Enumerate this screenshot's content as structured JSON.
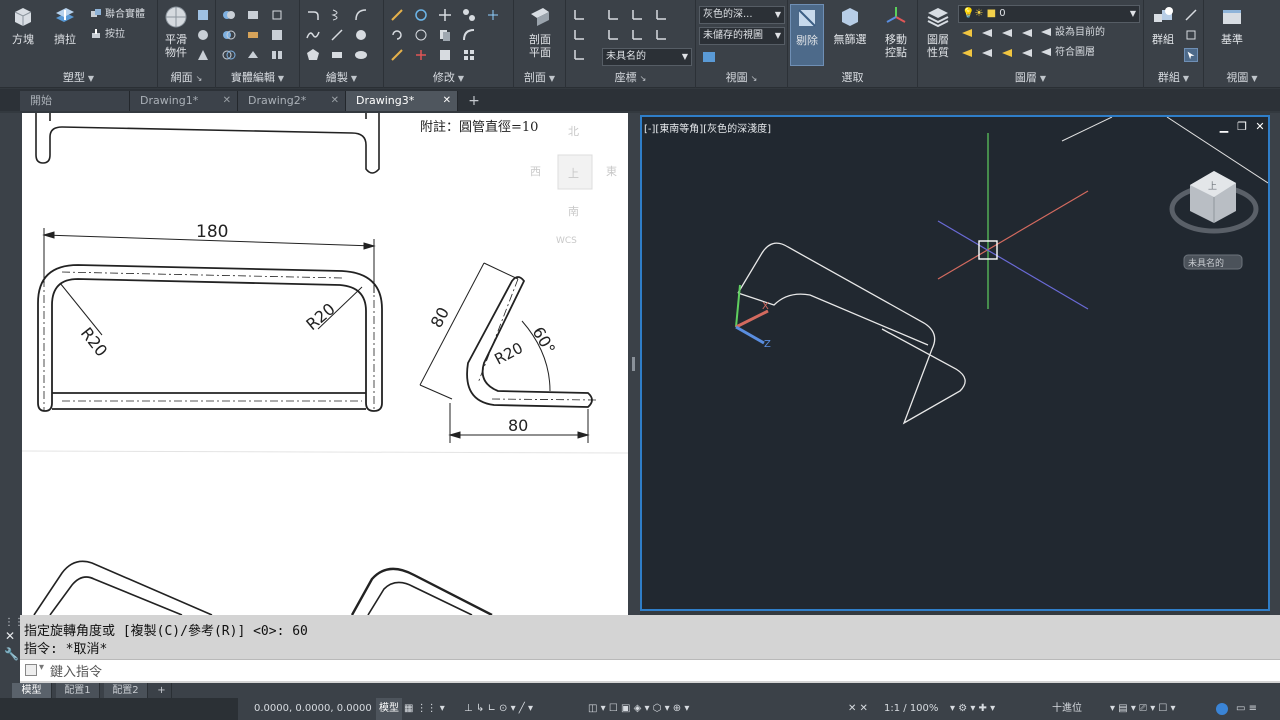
{
  "ribbon": {
    "panels": {
      "modeling": "塑型",
      "mesh": "網面",
      "solid_edit": "實體編輯",
      "draw": "繪製",
      "modify": "修改",
      "section": "剖面",
      "coordinates": "座標",
      "view": "視圖",
      "selection": "選取",
      "layers": "圖層",
      "groups": "群組",
      "view2": "視圖"
    },
    "buttons": {
      "box": "方塊",
      "extrude": "擠拉",
      "smooth_object": "平滑\n物件",
      "section_plane": "剖面\n平面",
      "culling": "剔除",
      "no_filter": "無篩選",
      "move_gizmo": "移動\n控點",
      "layer_properties": "圖層\n性質",
      "group": "群組",
      "base": "基準"
    },
    "small": {
      "solid_union": "聯合實體",
      "presspull": "按拉",
      "set_current": "設為目前的",
      "match_layer": "符合圖層"
    },
    "combos": {
      "visual_style": "灰色的深...",
      "saved_view": "未儲存的視圖",
      "ucs_name": "未具名的",
      "layer": "0"
    }
  },
  "tabs": [
    {
      "label": "開始",
      "active": false
    },
    {
      "label": "Drawing1*",
      "active": false
    },
    {
      "label": "Drawing2*",
      "active": false
    },
    {
      "label": "Drawing3*",
      "active": true
    }
  ],
  "drawing": {
    "note": "附註：圓管直徑=10",
    "dim_180": "180",
    "dim_r20_a": "R20",
    "dim_r20_b": "R20",
    "dim_80_slant": "80",
    "dim_80_bottom": "80",
    "dim_r20_c": "R20",
    "dim_angle": "60°",
    "compass": {
      "north": "北",
      "west": "西",
      "top": "上",
      "east": "東",
      "south": "南",
      "wcs": "WCS"
    }
  },
  "viewport": {
    "label": "[-][東南等角][灰色的深淺度]",
    "viewcube_name": "未具名的",
    "viewcube_face": "上"
  },
  "command": {
    "line1": "指定旋轉角度或 [複製(C)/參考(R)] <0>: 60",
    "line2": "指令: *取消*",
    "placeholder": "鍵入指令"
  },
  "layouts": [
    {
      "label": "模型",
      "active": true
    },
    {
      "label": "配置1",
      "active": false
    },
    {
      "label": "配置2",
      "active": false
    }
  ],
  "status": {
    "coords": "0.0000, 0.0000, 0.0000",
    "model": "模型",
    "scale": "1:1 / 100%",
    "units": "十進位"
  }
}
